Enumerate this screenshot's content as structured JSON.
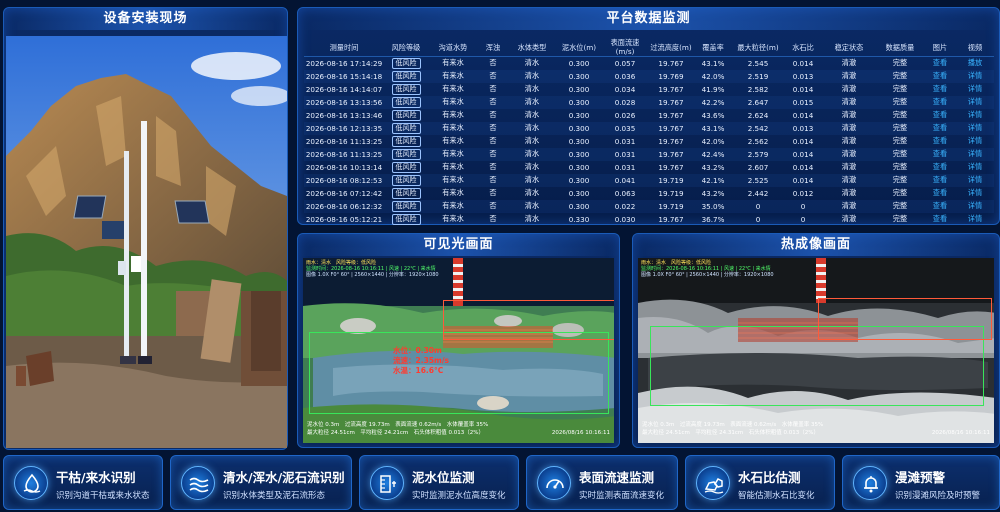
{
  "site": {
    "title": "设备安装现场"
  },
  "monitor": {
    "title": "平台数据监测",
    "columns": [
      "测量时间",
      "风险等级",
      "沟道水势",
      "浑浊",
      "水体类型",
      "泥水位(m)",
      "表面流速(m/s)",
      "过流高度(m)",
      "覆盖率",
      "最大粒径(m)",
      "水石比",
      "稳定状态",
      "数据质量",
      "图片",
      "视频"
    ],
    "rows": [
      [
        "2026-08-16 17:14:29",
        "低风险",
        "有来水",
        "否",
        "清水",
        "0.300",
        "0.057",
        "19.767",
        "43.1%",
        "2.545",
        "0.014",
        "清澈",
        "完整",
        "查看",
        "播放"
      ],
      [
        "2026-08-16 15:14:18",
        "低风险",
        "有来水",
        "否",
        "清水",
        "0.300",
        "0.036",
        "19.769",
        "42.0%",
        "2.519",
        "0.013",
        "清澈",
        "完整",
        "查看",
        "详情"
      ],
      [
        "2026-08-16 14:14:07",
        "低风险",
        "有来水",
        "否",
        "清水",
        "0.300",
        "0.034",
        "19.767",
        "41.9%",
        "2.582",
        "0.014",
        "清澈",
        "完整",
        "查看",
        "详情"
      ],
      [
        "2026-08-16 13:13:56",
        "低风险",
        "有来水",
        "否",
        "清水",
        "0.300",
        "0.028",
        "19.767",
        "42.2%",
        "2.647",
        "0.015",
        "清澈",
        "完整",
        "查看",
        "详情"
      ],
      [
        "2026-08-16 13:13:46",
        "低风险",
        "有来水",
        "否",
        "清水",
        "0.300",
        "0.026",
        "19.767",
        "43.6%",
        "2.624",
        "0.014",
        "清澈",
        "完整",
        "查看",
        "详情"
      ],
      [
        "2026-08-16 12:13:35",
        "低风险",
        "有来水",
        "否",
        "清水",
        "0.300",
        "0.035",
        "19.767",
        "43.1%",
        "2.542",
        "0.013",
        "清澈",
        "完整",
        "查看",
        "详情"
      ],
      [
        "2026-08-16 11:13:25",
        "低风险",
        "有来水",
        "否",
        "清水",
        "0.300",
        "0.031",
        "19.767",
        "42.0%",
        "2.562",
        "0.014",
        "清澈",
        "完整",
        "查看",
        "详情"
      ],
      [
        "2026-08-16 11:13:25",
        "低风险",
        "有来水",
        "否",
        "清水",
        "0.300",
        "0.031",
        "19.767",
        "42.4%",
        "2.579",
        "0.014",
        "清澈",
        "完整",
        "查看",
        "详情"
      ],
      [
        "2026-08-16 10:13:14",
        "低风险",
        "有来水",
        "否",
        "清水",
        "0.300",
        "0.031",
        "19.767",
        "43.2%",
        "2.607",
        "0.014",
        "清澈",
        "完整",
        "查看",
        "详情"
      ],
      [
        "2026-08-16 08:12:53",
        "低风险",
        "有来水",
        "否",
        "清水",
        "0.300",
        "0.041",
        "19.719",
        "42.1%",
        "2.525",
        "0.014",
        "清澈",
        "完整",
        "查看",
        "详情"
      ],
      [
        "2026-08-16 07:12:42",
        "低风险",
        "有来水",
        "否",
        "清水",
        "0.300",
        "0.063",
        "19.719",
        "43.2%",
        "2.442",
        "0.012",
        "清澈",
        "完整",
        "查看",
        "详情"
      ],
      [
        "2026-08-16 06:12:32",
        "低风险",
        "有来水",
        "否",
        "清水",
        "0.300",
        "0.022",
        "19.719",
        "35.0%",
        "0",
        "0",
        "清澈",
        "完整",
        "查看",
        "详情"
      ],
      [
        "2026-08-16 05:12:21",
        "低风险",
        "有来水",
        "否",
        "清水",
        "0.330",
        "0.030",
        "19.767",
        "36.7%",
        "0",
        "0",
        "清澈",
        "完整",
        "查看",
        "详情"
      ]
    ]
  },
  "visible": {
    "title": "可见光画面",
    "osd1": "雨水：清水　风险等级：低风险",
    "osd2": "监测时间：2026-08-16 10:16:11 | 风速 | 22℃ | 来水情",
    "osd3": "图像 1.0X F0° 60° | 2560×1440 | 分辨率：1920×1080",
    "readout": [
      "水位：0.30m",
      "流速：2.35m/s",
      "水温：16.6°C"
    ],
    "foot1": "泥水位 0.3m　过流高度 19.73m　表面流速 0.62m/s　水体覆盖率 35%",
    "foot2": "最大粒径 24.51cm　平均粒径 24.21cm　石头体积粗值 0.013（2%）",
    "date": "2026/08/16 10:16:11"
  },
  "thermal": {
    "title": "热成像画面",
    "osd1": "雨水：清水　风险等级：低风险",
    "osd2": "监测时间：2026-08-16 10:16:11 | 风速 | 22℃ | 来水情",
    "osd3": "图像 1.0X F0° 60° | 2560×1440 | 分辨率：1920×1080",
    "foot1": "泥水位 0.3m　过流高度 19.73m　表面流速 0.62m/s　水体覆盖率 35%",
    "foot2": "最大粒径 24.51cm　平均粒径 24.31cm　石头体积粗值 0.013（2%）",
    "date": "2026/08/16 10:16:11"
  },
  "features": [
    {
      "title": "干枯/来水识别",
      "desc": "识别沟道干枯或来水状态",
      "icon": "water-drop-icon"
    },
    {
      "title": "清水/浑水/泥石流识别",
      "desc": "识别水体类型及泥石流形态",
      "icon": "wave-icon"
    },
    {
      "title": "泥水位监测",
      "desc": "实时监测泥水位高度变化",
      "icon": "water-gauge-icon"
    },
    {
      "title": "表面流速监测",
      "desc": "实时监测表面流速变化",
      "icon": "speedometer-icon"
    },
    {
      "title": "水石比估测",
      "desc": "智能估测水石比变化",
      "icon": "rocks-icon"
    },
    {
      "title": "漫滩预警",
      "desc": "识别漫滩风险及时预警",
      "icon": "alarm-bell-icon"
    }
  ],
  "colors": {
    "background": "#031433",
    "panel": "#0a2a66",
    "border": "#1a5bb8",
    "link": "#39b4ff",
    "box": "#39e55a",
    "readout": "#ff3b2f"
  }
}
